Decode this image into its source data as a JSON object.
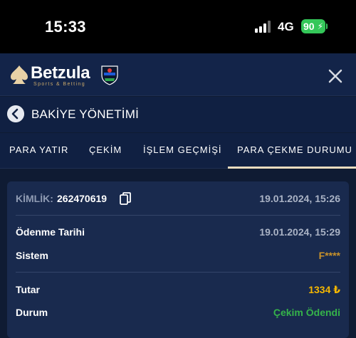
{
  "status_bar": {
    "time": "15:33",
    "network": "4G",
    "battery": "90"
  },
  "header": {
    "brand": "Betzula",
    "tagline": "Sports & Betting",
    "close_icon": "close-icon"
  },
  "page": {
    "title": "BAKİYE YÖNETİMİ"
  },
  "tabs": [
    {
      "label": "PARA YATIR"
    },
    {
      "label": "ÇEKİM"
    },
    {
      "label": "İŞLEM GEÇMİŞİ"
    },
    {
      "label": "PARA ÇEKME DURUMU",
      "active": true
    }
  ],
  "transaction": {
    "id_label": "KİMLİK:",
    "id_value": "262470619",
    "created_at": "19.01.2024, 15:26",
    "rows": [
      {
        "label": "Ödenme Tarihi",
        "value": "19.01.2024, 15:29"
      },
      {
        "label": "Sistem",
        "value": "F****"
      },
      {
        "label": "Tutar",
        "value": "1334 ₺"
      },
      {
        "label": "Durum",
        "value": "Çekim Ödendi"
      }
    ]
  },
  "colors": {
    "background": "#0f1b33",
    "card": "#192a4e",
    "accent_gold": "#f5b700",
    "system_gold": "#c9922a",
    "status_green": "#35b34a",
    "tab_underline": "#e9dcbf",
    "battery_green": "#34c759"
  }
}
